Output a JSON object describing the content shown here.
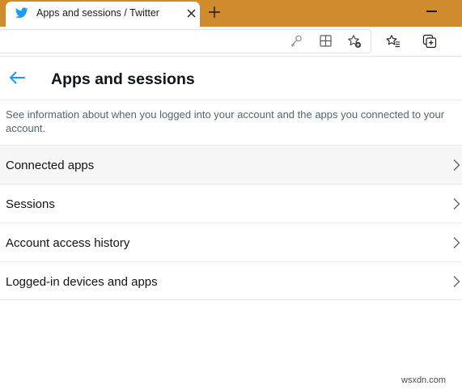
{
  "browser": {
    "tab": {
      "title": "Apps and sessions / Twitter",
      "favicon": "twitter-bird-icon"
    },
    "tabstrip_color": "#d08c2c",
    "toolbar_icons": [
      "key-icon",
      "extensions-grid-icon",
      "add-favorite-icon",
      "favorites-icon",
      "collections-icon"
    ]
  },
  "header": {
    "back_icon": "back-arrow-icon",
    "title": "Apps and sessions"
  },
  "description": "See information about when you logged into your account and the apps you connected to your account.",
  "list": {
    "items": [
      {
        "label": "Connected apps"
      },
      {
        "label": "Sessions"
      },
      {
        "label": "Account access history"
      },
      {
        "label": "Logged-in devices and apps"
      }
    ]
  },
  "watermark": "wsxdn.com",
  "colors": {
    "accent": "#1d9bf0",
    "text_primary": "#0f1419",
    "text_secondary": "#536471",
    "divider": "#e6ecf0"
  }
}
